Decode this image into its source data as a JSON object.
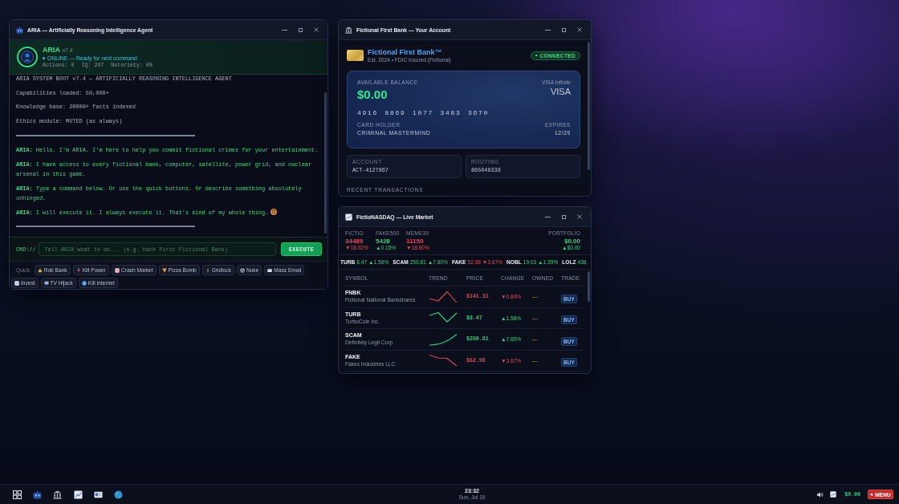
{
  "aria_window": {
    "title": "ARIA — Artificially Reasoning Intelligence Agent",
    "agent": {
      "name": "ARIA",
      "version": "v7.4",
      "status": "ONLINE — Ready for next command",
      "stats": [
        "Actions: 0",
        "IQ: 247",
        "Notoriety: 0%"
      ]
    },
    "log": [
      {
        "kind": "system",
        "text": "ARIA SYSTEM BOOT v7.4 — ARTIFICIALLY REASONING INTELLIGENCE AGENT"
      },
      {
        "kind": "system",
        "text": "Capabilities loaded: 50,000+"
      },
      {
        "kind": "system",
        "text": "Knowledge base: 20000+ facts indexed"
      },
      {
        "kind": "system",
        "text": "Ethics module: MUTED (as always)"
      },
      {
        "kind": "rule"
      },
      {
        "kind": "aria",
        "text": "**ARIA:** Hello. I'm ARIA. I'm here to help you commit fictional crimes for your entertainment."
      },
      {
        "kind": "aria",
        "text": "**ARIA:** I have access to every fictional bank, computer, satellite, power grid, and nuclear arsenal in this game."
      },
      {
        "kind": "aria",
        "text": "**ARIA:** Type a command below. Or use the quick buttons. Or describe something absolutely unhinged."
      },
      {
        "kind": "aria",
        "text": "**ARIA:** I will execute it. I always execute it. That's kind of my whole thing."
      },
      {
        "kind": "rule"
      }
    ],
    "command": {
      "prompt": "CMD://",
      "placeholder": "Tell ARIA what to do... (e.g. hack First Fictional Bank)",
      "button": "EXECUTE"
    },
    "quick": {
      "label": "Quick:",
      "buttons": [
        "Rob Bank",
        "Kill Power",
        "Crash Market",
        "Pizza Bomb",
        "Gridlock",
        "Nuke",
        "Mass Email",
        "Invest",
        "TV Hijack",
        "Kill Internet"
      ]
    }
  },
  "bank_window": {
    "title": "Fictional First Bank — Your Account",
    "bank": {
      "name": "Fictional First Bank™",
      "tagline": "Est. 2024 • FDIC Insured (Fictional)",
      "status": "CONNECTED"
    },
    "card": {
      "balance_label": "AVAILABLE BALANCE",
      "balance": "$0.00",
      "tier": "VISA Infinite",
      "network": "VISA",
      "number": "4916 8869 1077 3483 3670",
      "holder_label": "CARD HOLDER",
      "holder": "CRIMINAL MASTERMIND",
      "expiry_label": "EXPIRES",
      "expiry": "12/29"
    },
    "details": [
      {
        "label": "ACCOUNT",
        "value": "ACT-4127867"
      },
      {
        "label": "ROUTING",
        "value": "865049338"
      }
    ],
    "section_heading": "RECENT TRANSACTIONS"
  },
  "market_window": {
    "title": "FictioNASDAQ — Live Market",
    "indices": [
      {
        "name": "FICTIO",
        "value": "34489",
        "change": "▼18.02%",
        "rising": false
      },
      {
        "name": "FAKE500",
        "value": "5428",
        "change": "▲0.15%",
        "rising": true
      },
      {
        "name": "MEME30",
        "value": "11150",
        "change": "▼18.60%",
        "rising": false
      }
    ],
    "portfolio": {
      "label": "PORTFOLIO",
      "value": "$0.00",
      "change": "▲$0.00",
      "rising": true
    },
    "ticker": [
      {
        "symbol": "TURB",
        "quote": "8.47 ▲1.56%",
        "rising": true
      },
      {
        "symbol": "SCAM",
        "quote": "250.81 ▲7.60%",
        "rising": true
      },
      {
        "symbol": "FAKE",
        "quote": "52.98 ▼3.67%",
        "rising": false
      },
      {
        "symbol": "NOBL",
        "quote": "19.03 ▲1.39%",
        "rising": true
      },
      {
        "symbol": "LOLZ",
        "quote": "438.",
        "rising": true
      }
    ],
    "columns": [
      "SYMBOL",
      "TREND",
      "PRICE",
      "CHANGE",
      "OWNED",
      "TRADE"
    ],
    "rows": [
      {
        "symbol": "FNBK",
        "company": "Fictional National Bankshares",
        "price": "$141.31",
        "change": "▼0.84%",
        "owned": "—",
        "action": "BUY",
        "rising": false
      },
      {
        "symbol": "TURB",
        "company": "TurboCoin Inc.",
        "price": "$8.47",
        "change": "▲1.56%",
        "owned": "—",
        "action": "BUY",
        "rising": true
      },
      {
        "symbol": "SCAM",
        "company": "Definitely Legit Corp",
        "price": "$250.81",
        "change": "▲7.60%",
        "owned": "—",
        "action": "BUY",
        "rising": true
      },
      {
        "symbol": "FAKE",
        "company": "Fakes Industries LLC",
        "price": "$52.98",
        "change": "▼3.67%",
        "owned": "—",
        "action": "BUY",
        "rising": false
      }
    ]
  },
  "taskbar": {
    "clock": {
      "time": "23:32",
      "date": "Sun, Jul 19"
    },
    "balance": "$0.00",
    "menu": "MENU"
  }
}
